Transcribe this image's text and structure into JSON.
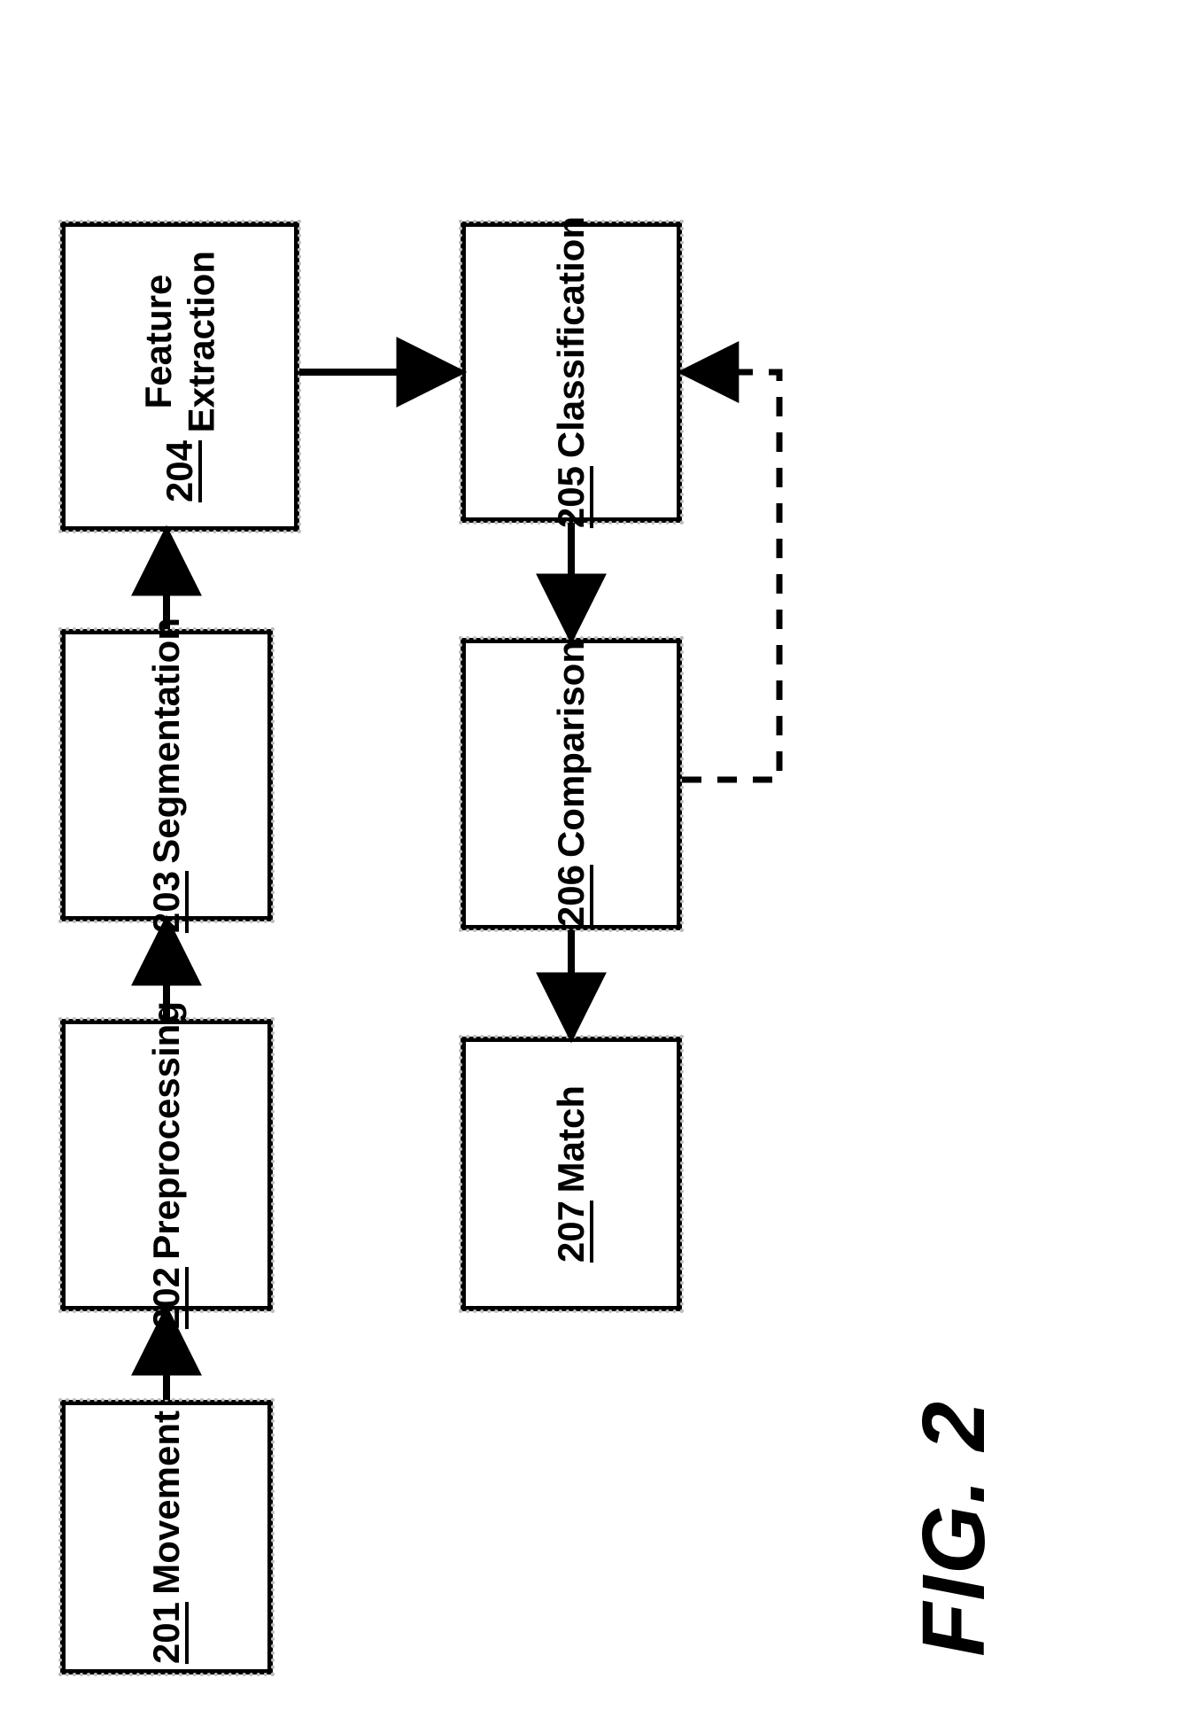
{
  "figure_label": "FIG. 2",
  "blocks": {
    "movement": {
      "title": "Movement",
      "num": "201"
    },
    "preprocessing": {
      "title": "Preprocessing",
      "num": "202"
    },
    "segmentation": {
      "title": "Segmentation",
      "num": "203"
    },
    "feature_extraction": {
      "title": "Feature\nExtraction",
      "num": "204"
    },
    "classification": {
      "title": "Classification",
      "num": "205"
    },
    "comparison": {
      "title": "Comparison",
      "num": "206"
    },
    "match": {
      "title": "Match",
      "num": "207"
    }
  },
  "chart_data": {
    "type": "flowchart",
    "nodes": [
      {
        "id": "201",
        "label": "Movement"
      },
      {
        "id": "202",
        "label": "Preprocessing"
      },
      {
        "id": "203",
        "label": "Segmentation"
      },
      {
        "id": "204",
        "label": "Feature Extraction"
      },
      {
        "id": "205",
        "label": "Classification"
      },
      {
        "id": "206",
        "label": "Comparison"
      },
      {
        "id": "207",
        "label": "Match"
      }
    ],
    "edges": [
      {
        "from": "201",
        "to": "202",
        "style": "solid"
      },
      {
        "from": "202",
        "to": "203",
        "style": "solid"
      },
      {
        "from": "203",
        "to": "204",
        "style": "solid"
      },
      {
        "from": "204",
        "to": "205",
        "style": "solid"
      },
      {
        "from": "205",
        "to": "206",
        "style": "solid"
      },
      {
        "from": "206",
        "to": "207",
        "style": "solid"
      },
      {
        "from": "206",
        "to": "205",
        "style": "dashed",
        "note": "feedback loop"
      }
    ]
  }
}
